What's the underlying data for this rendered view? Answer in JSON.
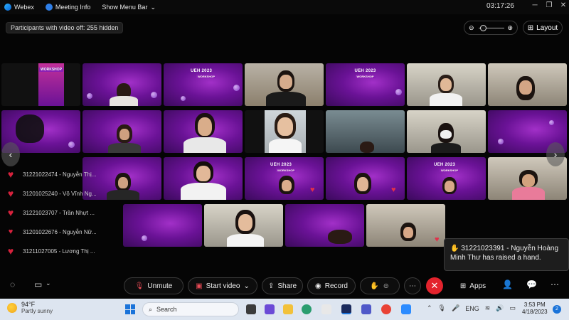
{
  "titlebar": {
    "app_name": "Webex",
    "meeting_info_label": "Meeting Info",
    "show_menu_label": "Show Menu Bar",
    "timer": "03:17:26"
  },
  "top": {
    "hidden_participants_label": "Participants with video off: 255 hidden",
    "layout_label": "Layout"
  },
  "tile_logo": {
    "workshop": "WORKSHOP",
    "ueh": "UEH",
    "year": "2023"
  },
  "participants_list": [
    {
      "label": "31221022474 - Nguyễn Thị..."
    },
    {
      "label": "31201025240 - Võ Vĩnh Ng..."
    },
    {
      "label": "31221023707 - Trần Nhựt ..."
    },
    {
      "label": "31201022676 - Nguyễn Nữ..."
    },
    {
      "label": "31211027005 - Lương Thị ..."
    }
  ],
  "hand_toast": {
    "text": "31221023391 - Nguyễn Hoàng Minh Thư  has raised a hand."
  },
  "controls": {
    "unmute_label": "Unmute",
    "start_video_label": "Start video",
    "share_label": "Share",
    "record_label": "Record",
    "apps_label": "Apps"
  },
  "taskbar": {
    "weather_temp": "94°F",
    "weather_cond": "Partly sunny",
    "search_placeholder": "Search",
    "lang": "ENG",
    "time": "3:53 PM",
    "date": "4/18/2023",
    "notifications": "2"
  },
  "colors": {
    "accent_purple": "#7a17a8",
    "leave_red": "#e3232d",
    "heart_red": "#d8223d",
    "taskbar_bg": "#dde5f0"
  }
}
